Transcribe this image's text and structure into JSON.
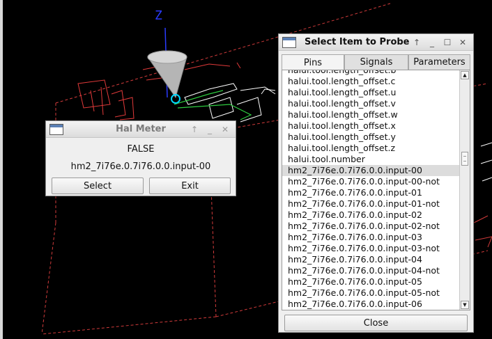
{
  "meter": {
    "title": "Hal Meter",
    "value": "FALSE",
    "pin": "hm2_7i76e.0.7i76.0.0.input-00",
    "select_label": "Select",
    "exit_label": "Exit"
  },
  "probe": {
    "title": "Select Item to Probe",
    "tabs": [
      "Pins",
      "Signals",
      "Parameters"
    ],
    "items": [
      "halui.tool.length_offset.b",
      "halui.tool.length_offset.c",
      "halui.tool.length_offset.u",
      "halui.tool.length_offset.v",
      "halui.tool.length_offset.w",
      "halui.tool.length_offset.x",
      "halui.tool.length_offset.y",
      "halui.tool.length_offset.z",
      "halui.tool.number",
      "hm2_7i76e.0.7i76.0.0.input-00",
      "hm2_7i76e.0.7i76.0.0.input-00-not",
      "hm2_7i76e.0.7i76.0.0.input-01",
      "hm2_7i76e.0.7i76.0.0.input-01-not",
      "hm2_7i76e.0.7i76.0.0.input-02",
      "hm2_7i76e.0.7i76.0.0.input-02-not",
      "hm2_7i76e.0.7i76.0.0.input-03",
      "hm2_7i76e.0.7i76.0.0.input-03-not",
      "hm2_7i76e.0.7i76.0.0.input-04",
      "hm2_7i76e.0.7i76.0.0.input-04-not",
      "hm2_7i76e.0.7i76.0.0.input-05",
      "hm2_7i76e.0.7i76.0.0.input-05-not",
      "hm2_7i76e.0.7i76.0.0.input-06"
    ],
    "selected_item": "hm2_7i76e.0.7i76.0.0.input-00",
    "close_label": "Close"
  },
  "backplot": {
    "axis_label": "Z"
  },
  "colors": {
    "background": "#000000",
    "axis_z": "#2a3bff",
    "path_red": "#e23a3a",
    "path_white": "#ffffff",
    "path_green": "#2ecc40",
    "tool_cone": "#bdbdbd"
  }
}
